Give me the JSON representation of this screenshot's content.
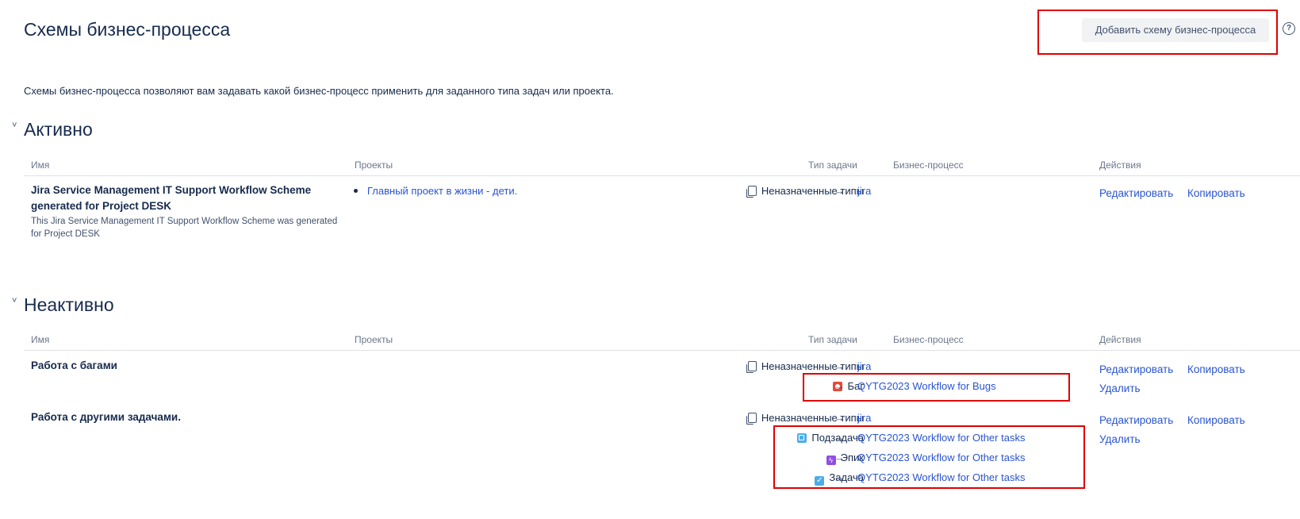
{
  "page": {
    "title": "Схемы бизнес-процесса",
    "add_button": "Добавить схему бизнес-процесса",
    "help_glyph": "?",
    "description": "Схемы бизнес-процесса позволяют вам задавать какой бизнес-процесс применить для заданного типа задач или проекта."
  },
  "columns": {
    "name": "Имя",
    "projects": "Проекты",
    "issue_type": "Тип задачи",
    "workflow": "Бизнес-процесс",
    "actions": "Действия"
  },
  "arrow_glyph": "→",
  "active": {
    "title": "Активно",
    "toggle_glyph": "˅",
    "schemes": [
      {
        "name_line1": "Jira Service Management IT Support Workflow Scheme",
        "name_line2": "generated for Project DESK",
        "desc_line1": "This Jira Service Management IT Support Workflow Scheme was generated",
        "desc_line2": "for Project DESK",
        "project": "Главный проект в жизни - дети.",
        "mappings": [
          {
            "type": "Неназначенные типы",
            "icon": "unassigned-icon",
            "workflow": "jira"
          }
        ],
        "actions": {
          "edit": "Редактировать",
          "copy": "Копировать"
        }
      }
    ]
  },
  "inactive": {
    "title": "Неактивно",
    "toggle_glyph": "˅",
    "schemes": [
      {
        "name": "Работа с багами",
        "mappings": [
          {
            "type": "Неназначенные типы",
            "icon": "unassigned-icon",
            "workflow": "jira"
          },
          {
            "type": "Баг",
            "icon": "bug-icon",
            "workflow": "QYTG2023 Workflow for Bugs"
          }
        ],
        "actions": {
          "edit": "Редактировать",
          "copy": "Копировать",
          "delete": "Удалить"
        }
      },
      {
        "name": "Работа с другими задачами.",
        "mappings": [
          {
            "type": "Неназначенные типы",
            "icon": "unassigned-icon",
            "workflow": "jira"
          },
          {
            "type": "Подзадача",
            "icon": "subtask-icon",
            "workflow": "QYTG2023 Workflow for Other tasks"
          },
          {
            "type": "Эпик",
            "icon": "epic-icon",
            "workflow": "QYTG2023 Workflow for Other tasks"
          },
          {
            "type": "Задача",
            "icon": "task-icon",
            "workflow": "QYTG2023 Workflow for Other tasks"
          }
        ],
        "actions": {
          "edit": "Редактировать",
          "copy": "Копировать",
          "delete": "Удалить"
        }
      }
    ]
  },
  "colors": {
    "highlight": "#e00000",
    "link": "#2954d1",
    "text": "#172b4d",
    "bug": "#e5493a",
    "epic": "#904ee2",
    "task": "#4bade8"
  },
  "icon_glyphs": {
    "epic": "ϟ",
    "task": "✓"
  }
}
